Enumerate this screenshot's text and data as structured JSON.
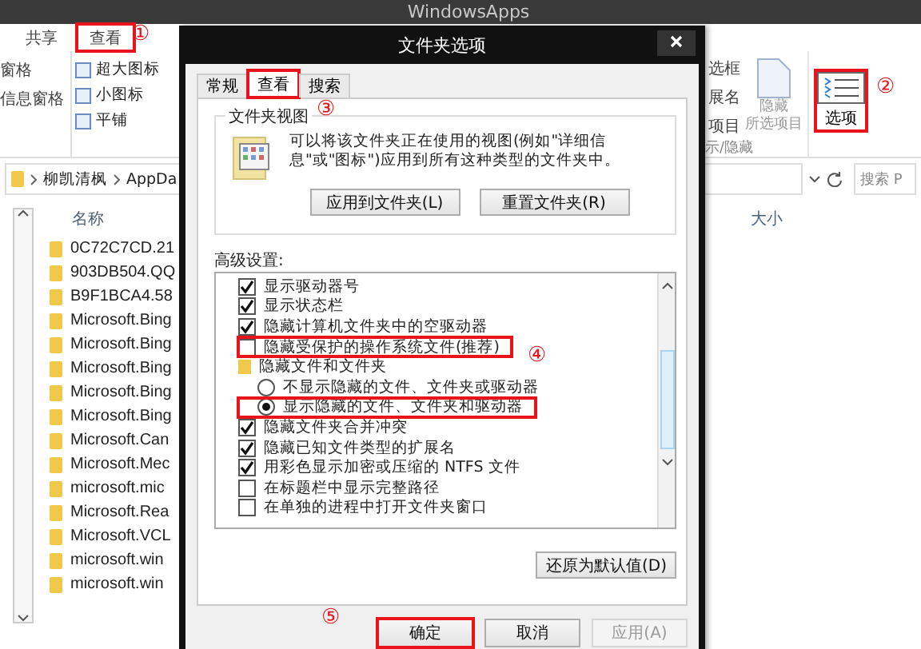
{
  "explorer": {
    "title": "WindowsApps",
    "ribbon_tabs": [
      {
        "label": "共享",
        "marked": false
      },
      {
        "label": "查看",
        "marked": true
      }
    ],
    "pane_labels": [
      "窗格",
      "信息窗格"
    ],
    "layout_items": [
      "超大图标",
      "小图标",
      "平铺"
    ],
    "show_hide_labels": [
      "选框",
      "展名",
      "项目"
    ],
    "show_hide_group": "示/隐藏",
    "hide_selected": [
      "隐藏",
      "所选项目"
    ],
    "options_button": {
      "label": "选项",
      "marked": true
    },
    "breadcrumb": [
      "柳凯清枫",
      "AppDa"
    ],
    "search_placeholder": "搜索 P",
    "columns": [
      "名称",
      "大小"
    ],
    "files": [
      "0C72C7CD.21",
      "903DB504.QQ",
      "B9F1BCA4.58",
      "Microsoft.Bing",
      "Microsoft.Bing",
      "Microsoft.Bing",
      "Microsoft.Bing",
      "Microsoft.Bing",
      "Microsoft.Can",
      "Microsoft.Mec",
      "microsoft.mic",
      "Microsoft.Rea",
      "Microsoft.VCL",
      "microsoft.win",
      "microsoft.win"
    ]
  },
  "dialog": {
    "title": "文件夹选项",
    "tabs": [
      {
        "label": "常规",
        "selected": false,
        "marked": false
      },
      {
        "label": "查看",
        "selected": true,
        "marked": true
      },
      {
        "label": "搜索",
        "selected": false,
        "marked": false
      }
    ],
    "folder_views": {
      "title": "文件夹视图",
      "description": "可以将该文件夹正在使用的视图(例如\"详细信息\"或\"图标\")应用到所有这种类型的文件夹中。",
      "buttons": [
        "应用到文件夹(L)",
        "重置文件夹(R)"
      ]
    },
    "advanced_label": "高级设置:",
    "settings": [
      {
        "kind": "checkbox",
        "label": "显示驱动器号",
        "checked": true,
        "marked": false
      },
      {
        "kind": "checkbox",
        "label": "显示状态栏",
        "checked": true,
        "marked": false
      },
      {
        "kind": "checkbox",
        "label": "隐藏计算机文件夹中的空驱动器",
        "checked": true,
        "marked": false
      },
      {
        "kind": "checkbox",
        "label": "隐藏受保护的操作系统文件(推荐)",
        "checked": false,
        "marked": true
      },
      {
        "kind": "folder",
        "label": "隐藏文件和文件夹",
        "marked": false
      },
      {
        "kind": "radio",
        "label": "不显示隐藏的文件、文件夹或驱动器",
        "selected": false,
        "marked": false
      },
      {
        "kind": "radio",
        "label": "显示隐藏的文件、文件夹和驱动器",
        "selected": true,
        "marked": true
      },
      {
        "kind": "checkbox",
        "label": "隐藏文件夹合并冲突",
        "checked": true,
        "marked": false
      },
      {
        "kind": "checkbox",
        "label": "隐藏已知文件类型的扩展名",
        "checked": true,
        "marked": false
      },
      {
        "kind": "checkbox",
        "label": "用彩色显示加密或压缩的 NTFS 文件",
        "checked": true,
        "marked": false
      },
      {
        "kind": "checkbox",
        "label": "在标题栏中显示完整路径",
        "checked": false,
        "marked": false
      },
      {
        "kind": "checkbox",
        "label": "在单独的进程中打开文件夹窗口",
        "checked": false,
        "marked": false
      }
    ],
    "restore_button": "还原为默认值(D)",
    "buttons": [
      {
        "label": "确定",
        "disabled": false,
        "marked": true
      },
      {
        "label": "取消",
        "disabled": false,
        "marked": false
      },
      {
        "label": "应用(A)",
        "disabled": true,
        "marked": false
      }
    ]
  },
  "callouts": [
    "①",
    "②",
    "③",
    "④",
    "⑤"
  ]
}
